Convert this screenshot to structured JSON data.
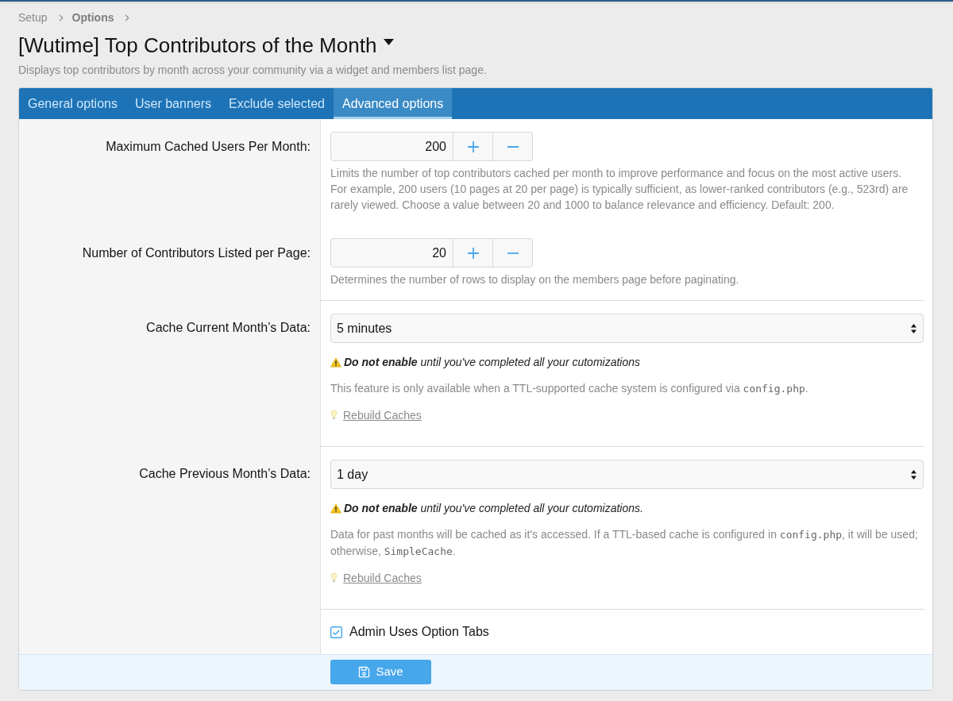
{
  "breadcrumb": [
    {
      "label": "Setup",
      "current": false
    },
    {
      "label": "Options",
      "current": true
    }
  ],
  "title": "[Wutime] Top Contributors of the Month",
  "description": "Displays top contributors by month across your community via a widget and members list page.",
  "tabs": [
    {
      "label": "General options",
      "selected": false
    },
    {
      "label": "User banners",
      "selected": false
    },
    {
      "label": "Exclude selected",
      "selected": false
    },
    {
      "label": "Advanced options",
      "selected": true
    }
  ],
  "sections": [
    {
      "rows": [
        {
          "kind": "number",
          "label": "Maximum Cached Users Per Month:",
          "value": "200",
          "explain": [
            {
              "kind": "text",
              "text": "Limits the number of top contributors cached per month to improve performance and focus on the most active users. For example, 200 users (10 pages at 20 per page) is typically sufficient, as lower-ranked contributors (e.g., 523rd) are rarely viewed. Choose a value between 20 and 1000 to balance relevance and efficiency. Default: 200."
            }
          ]
        },
        {
          "kind": "number",
          "label": "Number of Contributors Listed per Page:",
          "value": "20",
          "explain": [
            {
              "kind": "text",
              "text": "Determines the number of rows to display on the members page before paginating."
            }
          ]
        }
      ]
    },
    {
      "rows": [
        {
          "kind": "select",
          "label": "Cache Current Month’s Data:",
          "value": "5 minutes",
          "warning": "**Do not enable** until you've completed all your cutomizations",
          "explain": [
            {
              "kind": "text",
              "text": "This feature is only available when a TTL-supported cache system is configured via "
            },
            {
              "kind": "code",
              "text": "config.php"
            },
            {
              "kind": "text",
              "text": "."
            }
          ],
          "link": "Rebuild Caches"
        }
      ]
    },
    {
      "rows": [
        {
          "kind": "select",
          "label": "Cache Previous Month’s Data:",
          "value": "1 day",
          "warning": "**Do not enable** until you've completed all your cutomizations.",
          "explain": [
            {
              "kind": "text",
              "text": "Data for past months will be cached as it's accessed. If a TTL-based cache is configured in "
            },
            {
              "kind": "code",
              "text": "config.php"
            },
            {
              "kind": "text",
              "text": ", it will be used; otherwise, "
            },
            {
              "kind": "code",
              "text": "SimpleCache"
            },
            {
              "kind": "text",
              "text": "."
            }
          ],
          "link": "Rebuild Caches"
        }
      ]
    },
    {
      "rows": [
        {
          "kind": "checkbox",
          "label": "Admin Uses Option Tabs",
          "checked": true
        }
      ]
    }
  ],
  "save_button": "Save"
}
